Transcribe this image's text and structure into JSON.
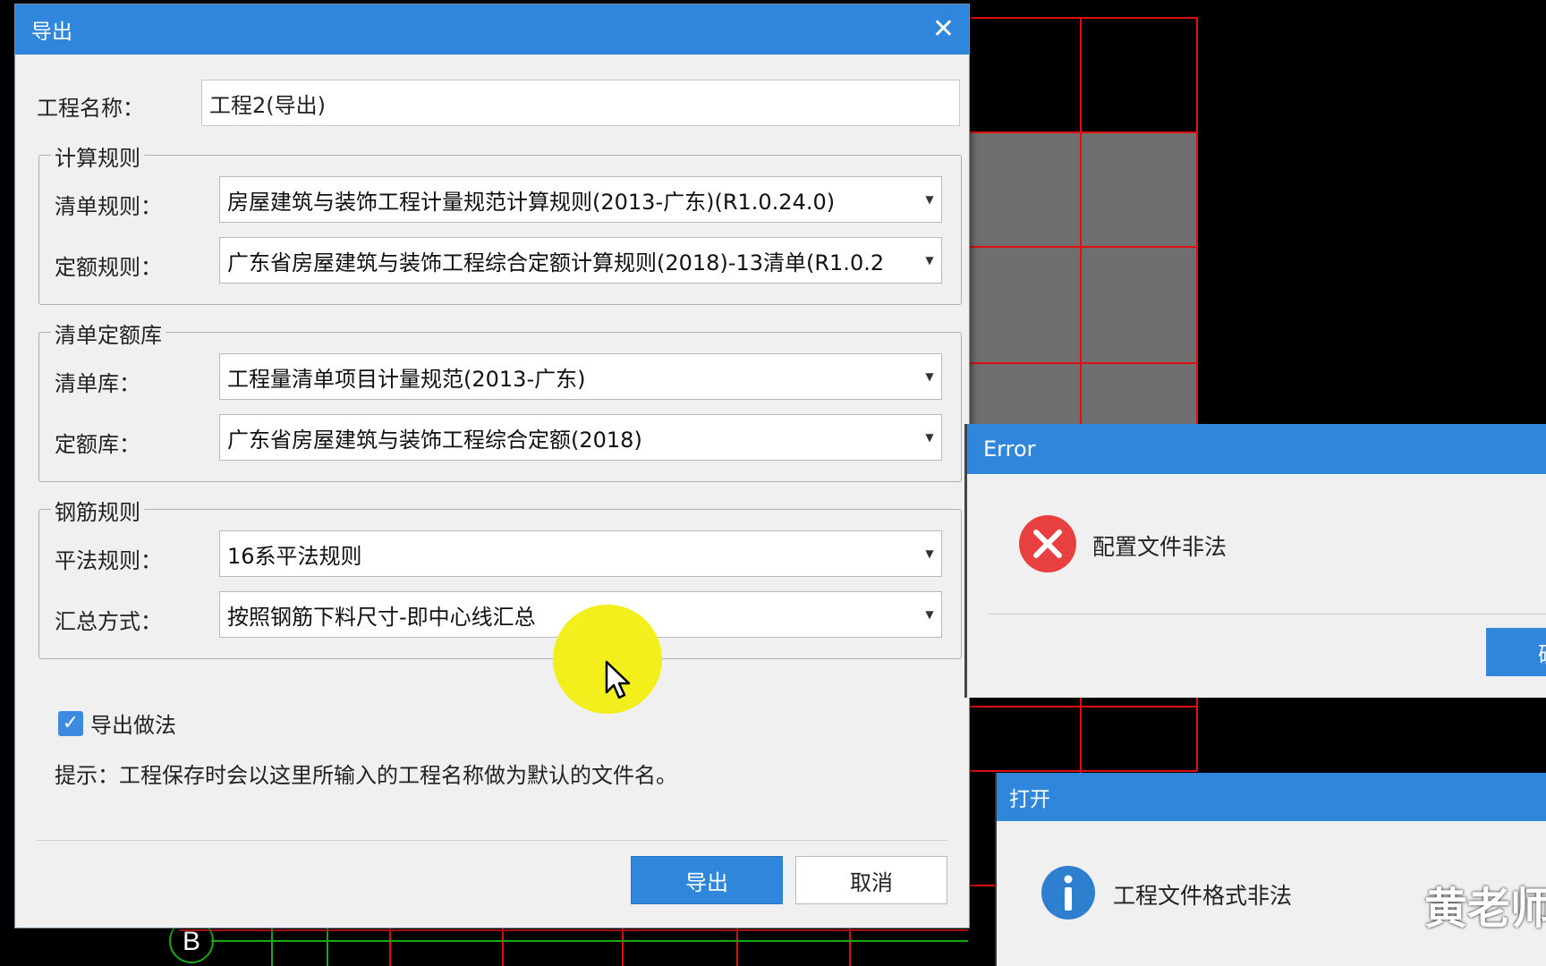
{
  "export_dialog": {
    "title": "导出",
    "close_glyph": "✕",
    "project_name_label": "工程名称：",
    "project_name_value": "工程2(导出)",
    "calc_rules_group": "计算规则",
    "list_rule_label": "清单规则：",
    "list_rule_value": "房屋建筑与装饰工程计量规范计算规则(2013-广东)(R1.0.24.0)",
    "quota_rule_label": "定额规则：",
    "quota_rule_value": "广东省房屋建筑与装饰工程综合定额计算规则(2018)-13清单(R1.0.2",
    "library_group": "清单定额库",
    "list_lib_label": "清单库：",
    "list_lib_value": "工程量清单项目计量规范(2013-广东)",
    "quota_lib_label": "定额库：",
    "quota_lib_value": "广东省房屋建筑与装饰工程综合定额(2018)",
    "rebar_group": "钢筋规则",
    "flat_rule_label": "平法规则：",
    "flat_rule_value": "16系平法规则",
    "summary_label": "汇总方式：",
    "summary_value": "按照钢筋下料尺寸-即中心线汇总",
    "export_method_label": "导出做法",
    "export_method_checked": true,
    "hint": "提示：工程保存时会以这里所输入的工程名称做为默认的文件名。",
    "export_button": "导出",
    "cancel_button": "取消"
  },
  "error_dialog": {
    "title": "Error",
    "message": "配置文件非法",
    "icon": "error-icon",
    "button_partial": "确"
  },
  "open_dialog": {
    "title": "打开",
    "message": "工程文件格式非法",
    "icon": "info-icon"
  },
  "cad": {
    "axis_label": "B",
    "watermark": "黄老师"
  },
  "colors": {
    "accent": "#2f86db",
    "error": "#e84040",
    "info": "#2f7fd0",
    "grid": "#e01010"
  }
}
